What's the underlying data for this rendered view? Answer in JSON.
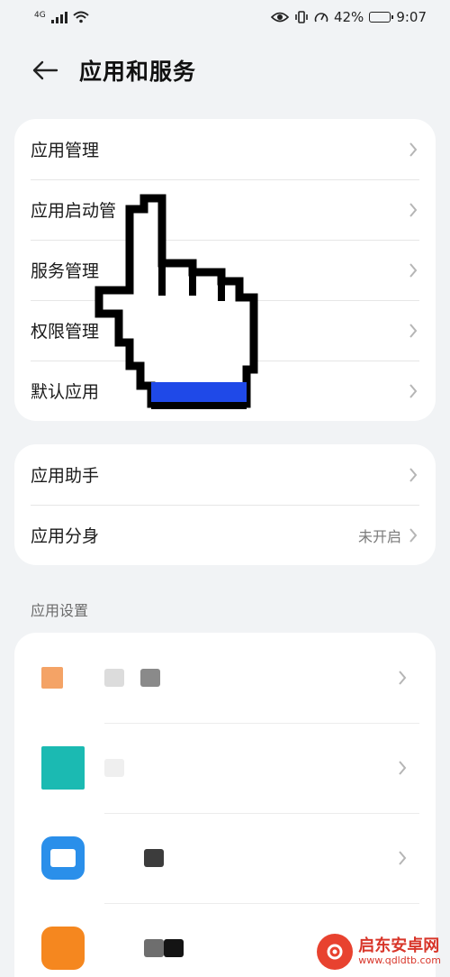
{
  "status_bar": {
    "network": "4G",
    "battery_percent": "42%",
    "battery_level": 0.42,
    "time": "9:07"
  },
  "header": {
    "title": "应用和服务"
  },
  "group1": {
    "items": [
      {
        "label": "应用管理"
      },
      {
        "label": "应用启动管"
      },
      {
        "label": "服务管理"
      },
      {
        "label": "权限管理"
      },
      {
        "label": "默认应用"
      }
    ]
  },
  "group2": {
    "items": [
      {
        "label": "应用助手",
        "value": ""
      },
      {
        "label": "应用分身",
        "value": "未开启"
      }
    ]
  },
  "app_settings": {
    "section_title": "应用设置"
  },
  "colors": {
    "app1": "#f4a366",
    "app2": "#1bbab2",
    "app3": "#2a8fea",
    "app4": "#f5871f",
    "cursor_fill": "#1f49e8"
  },
  "watermark": {
    "name": "启东安卓网",
    "url": "www.qdldtb.com"
  }
}
